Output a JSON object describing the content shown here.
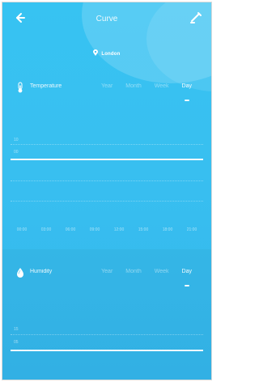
{
  "header": {
    "title": "Curve",
    "back_icon": "arrow-left-icon",
    "edit_icon": "pencil-icon"
  },
  "location": {
    "label": "London",
    "icon": "location-pin-icon"
  },
  "temperature": {
    "label": "Temperature",
    "icon": "thermometer-icon",
    "tabs": [
      "Year",
      "Month",
      "Week",
      "Day"
    ],
    "active_tab": "Day",
    "y_ticks": [
      "10",
      "00"
    ],
    "x_ticks": [
      "00:00",
      "03:00",
      "06:00",
      "09:00",
      "12:00",
      "15:00",
      "18:00",
      "21:00"
    ]
  },
  "humidity": {
    "label": "Humidity",
    "icon": "water-drop-icon",
    "tabs": [
      "Year",
      "Month",
      "Week",
      "Day"
    ],
    "active_tab": "Day",
    "y_ticks": [
      "15",
      "05"
    ]
  }
}
